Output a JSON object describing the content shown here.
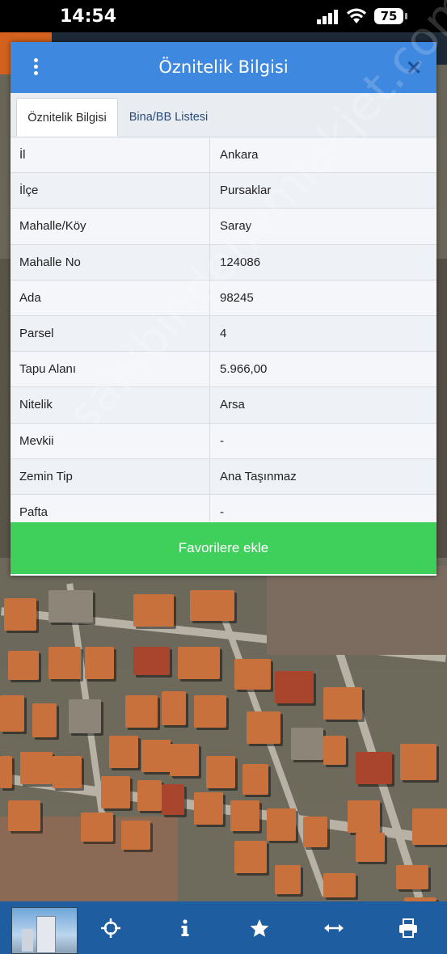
{
  "status_bar": {
    "time": "14:54",
    "battery": "75"
  },
  "dialog": {
    "title": "Öznitelik Bilgisi",
    "tabs": [
      {
        "label": "Öznitelik Bilgisi",
        "active": true
      },
      {
        "label": "Bina/BB Listesi",
        "active": false
      }
    ],
    "rows": [
      {
        "key": "İl",
        "value": "Ankara"
      },
      {
        "key": "İlçe",
        "value": "Pursaklar"
      },
      {
        "key": "Mahalle/Köy",
        "value": "Saray"
      },
      {
        "key": "Mahalle No",
        "value": "124086"
      },
      {
        "key": "Ada",
        "value": "98245"
      },
      {
        "key": "Parsel",
        "value": "4"
      },
      {
        "key": "Tapu Alanı",
        "value": "5.966,00"
      },
      {
        "key": "Nitelik",
        "value": "Arsa"
      },
      {
        "key": "Mevkii",
        "value": "-"
      },
      {
        "key": "Zemin Tip",
        "value": "Ana Taşınmaz"
      },
      {
        "key": "Pafta",
        "value": "-"
      }
    ],
    "favorite_button": "Favorilere ekle"
  },
  "watermark": "sahibindenemlakjet.com",
  "bottom_bar": {
    "icons": [
      "crosshair-icon",
      "info-icon",
      "star-icon",
      "arrows-icon",
      "print-icon"
    ]
  },
  "colors": {
    "header": "#3f88e0",
    "favorite_button": "#3ed05a",
    "bottom_bar": "#1d5da0"
  }
}
